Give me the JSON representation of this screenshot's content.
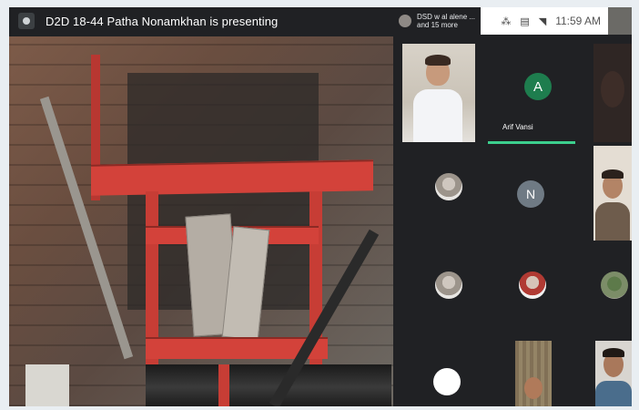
{
  "presentation_banner": {
    "text": "D2D 18-44 Patha Nonamkhan is presenting",
    "icon": "presentation-icon"
  },
  "panel_header": {
    "line1": "DSD w al alene ...",
    "line2": "and 15 more"
  },
  "status_bar": {
    "time": "11:59 AM",
    "icons": [
      "notification-icon",
      "sim-icon",
      "wifi-icon"
    ]
  },
  "participants": [
    {
      "type": "video",
      "description": "speaker"
    },
    {
      "type": "avatar",
      "initial": "A",
      "name": "Arif Vansi",
      "color": "#1e7d4e",
      "active": true
    },
    {
      "type": "video",
      "description": "dark"
    },
    {
      "type": "photo"
    },
    {
      "type": "avatar",
      "initial": "N",
      "color": "#6f7a84"
    },
    {
      "type": "video"
    },
    {
      "type": "photo"
    },
    {
      "type": "photo"
    },
    {
      "type": "photo"
    },
    {
      "type": "avatar-blank"
    },
    {
      "type": "video"
    },
    {
      "type": "video"
    }
  ],
  "colors": {
    "active_speaker": "#3ccf8e",
    "background": "#202124"
  }
}
